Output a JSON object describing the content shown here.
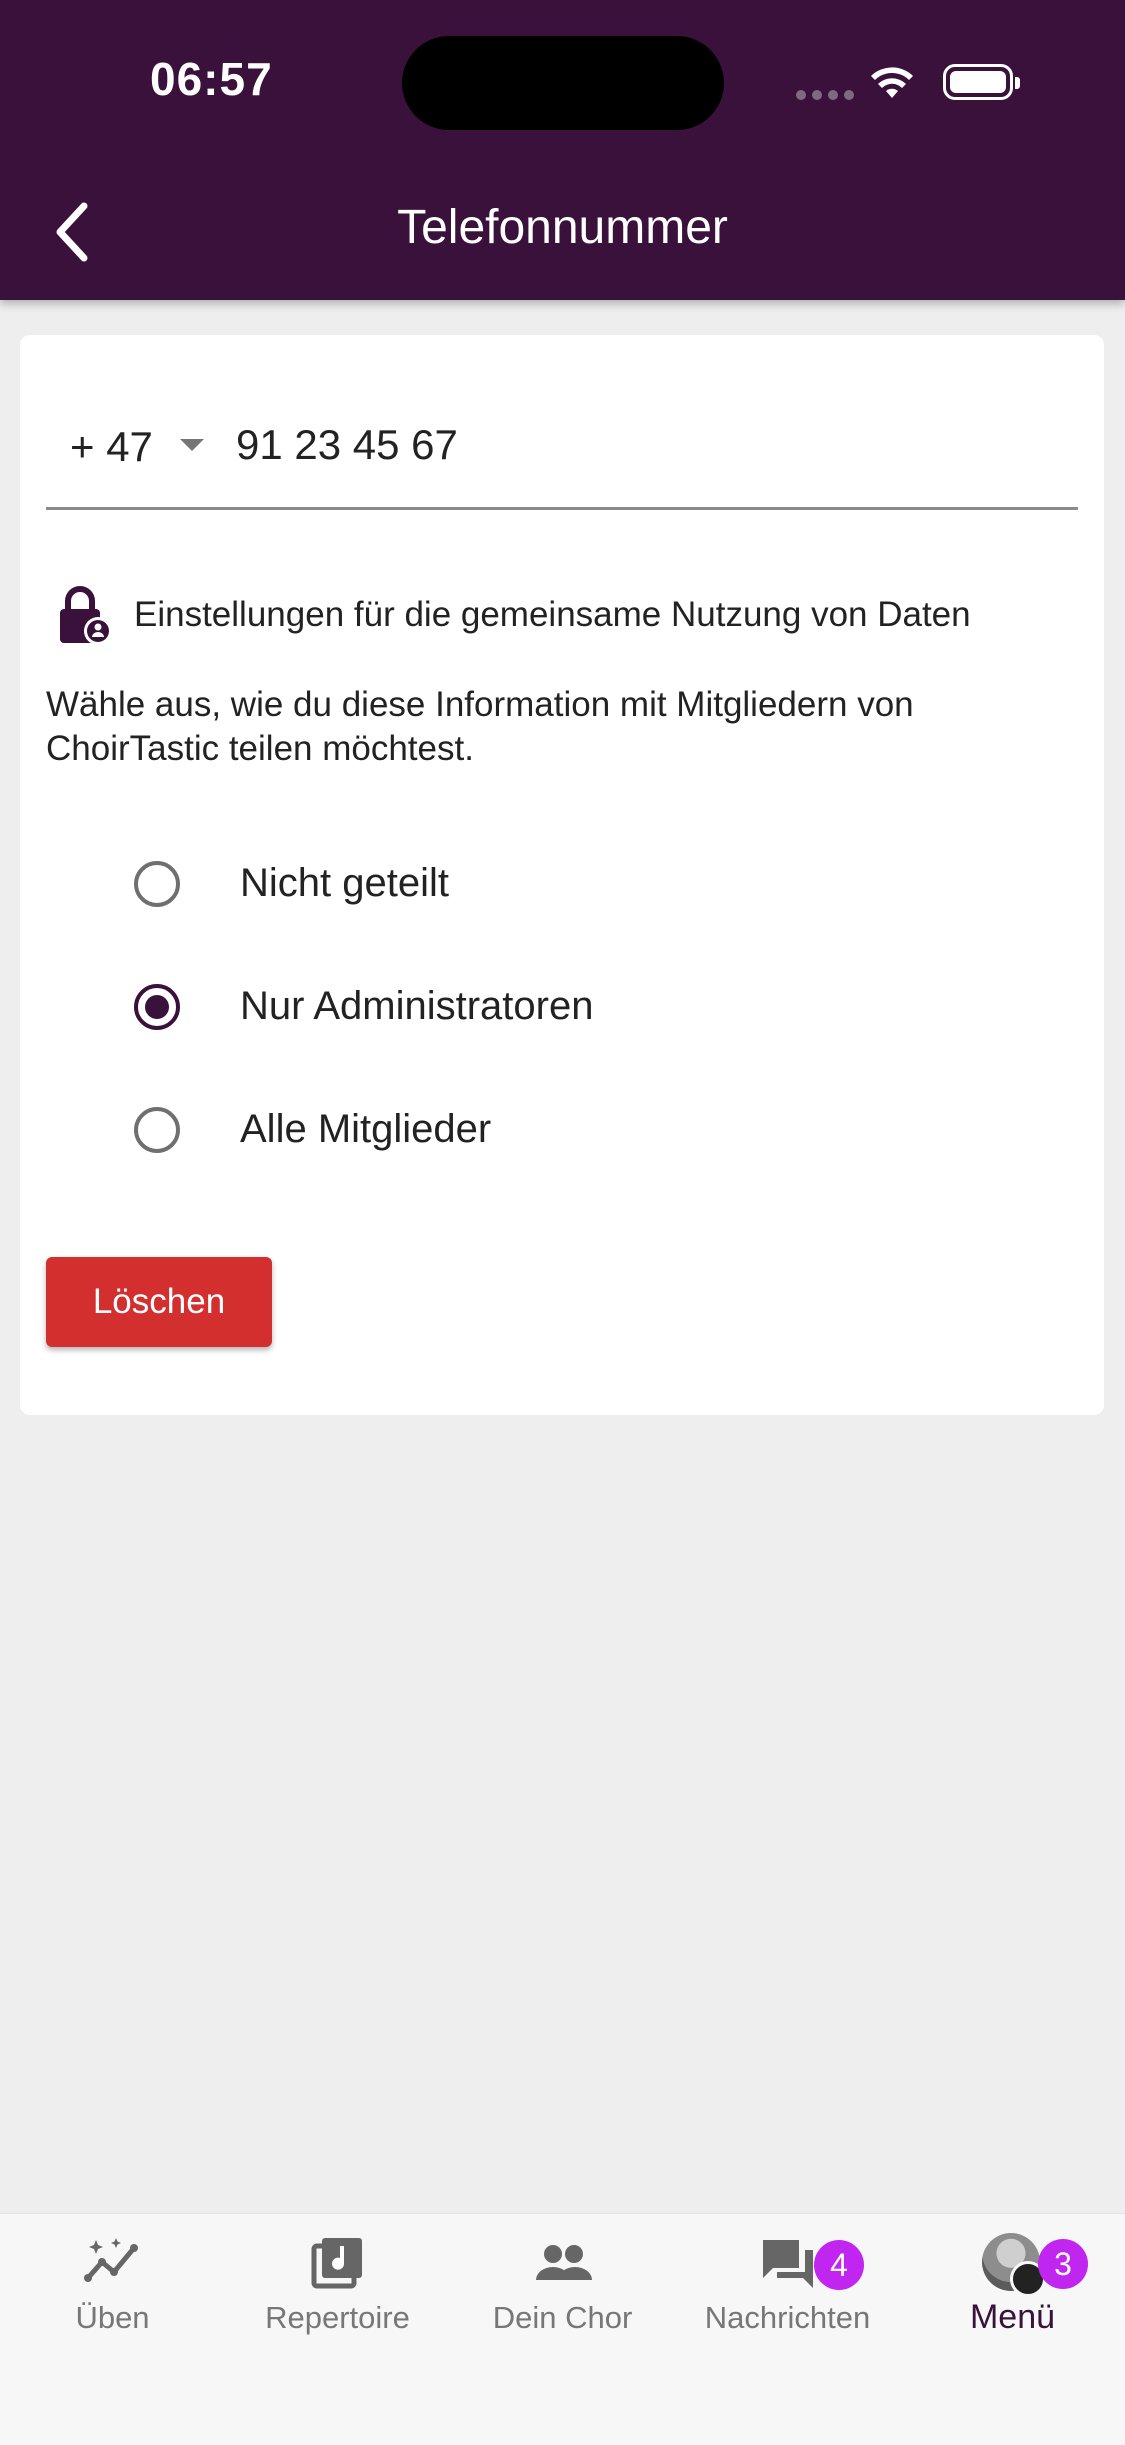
{
  "status_bar": {
    "time": "06:57"
  },
  "header": {
    "title": "Telefonnummer"
  },
  "phone": {
    "country_code": "+ 47",
    "number": "91 23 45 67"
  },
  "privacy": {
    "title": "Einstellungen für die gemeinsame Nutzung von Daten",
    "description": "Wähle aus, wie du diese Information mit Mitgliedern von ChoirTastic teilen möchtest.",
    "options": [
      {
        "label": "Nicht geteilt",
        "selected": false
      },
      {
        "label": "Nur Administratoren",
        "selected": true
      },
      {
        "label": "Alle Mitglieder",
        "selected": false
      }
    ]
  },
  "actions": {
    "delete_label": "Löschen"
  },
  "bottom_nav": {
    "items": [
      {
        "label": "Üben",
        "icon": "practice-icon"
      },
      {
        "label": "Repertoire",
        "icon": "music-library-icon"
      },
      {
        "label": "Dein Chor",
        "icon": "group-icon"
      },
      {
        "label": "Nachrichten",
        "icon": "chat-icon",
        "badge": "4"
      },
      {
        "label": "Menü",
        "icon": "avatar-menu-icon",
        "badge": "3",
        "active": true
      }
    ]
  },
  "colors": {
    "primary": "#3a113b",
    "danger": "#d32f2f",
    "badge": "#c026f0",
    "background": "#eeeeee"
  }
}
